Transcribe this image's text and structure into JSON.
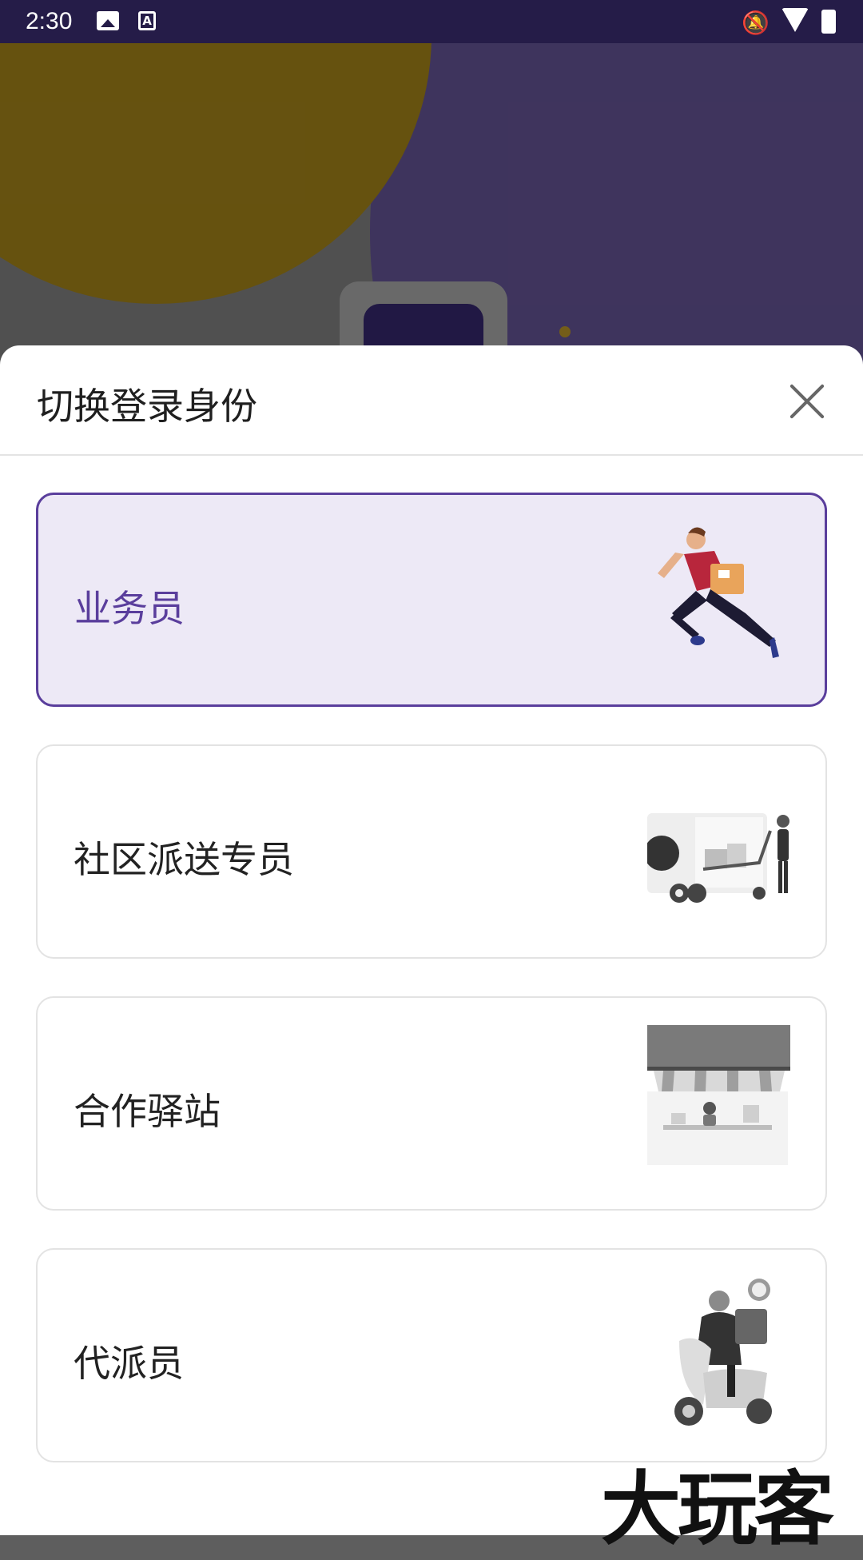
{
  "status_bar": {
    "time": "2:30"
  },
  "sheet": {
    "title": "切换登录身份",
    "options": [
      {
        "label": "业务员",
        "selected": true,
        "icon": "courier-running-icon"
      },
      {
        "label": "社区派送专员",
        "selected": false,
        "icon": "delivery-truck-icon"
      },
      {
        "label": "合作驿站",
        "selected": false,
        "icon": "storefront-icon"
      },
      {
        "label": "代派员",
        "selected": false,
        "icon": "scooter-rider-icon"
      }
    ]
  },
  "watermark": "大玩客",
  "colors": {
    "accent": "#5a3e9c",
    "selected_bg": "#ede9f6",
    "status_bar": "#251c48"
  }
}
